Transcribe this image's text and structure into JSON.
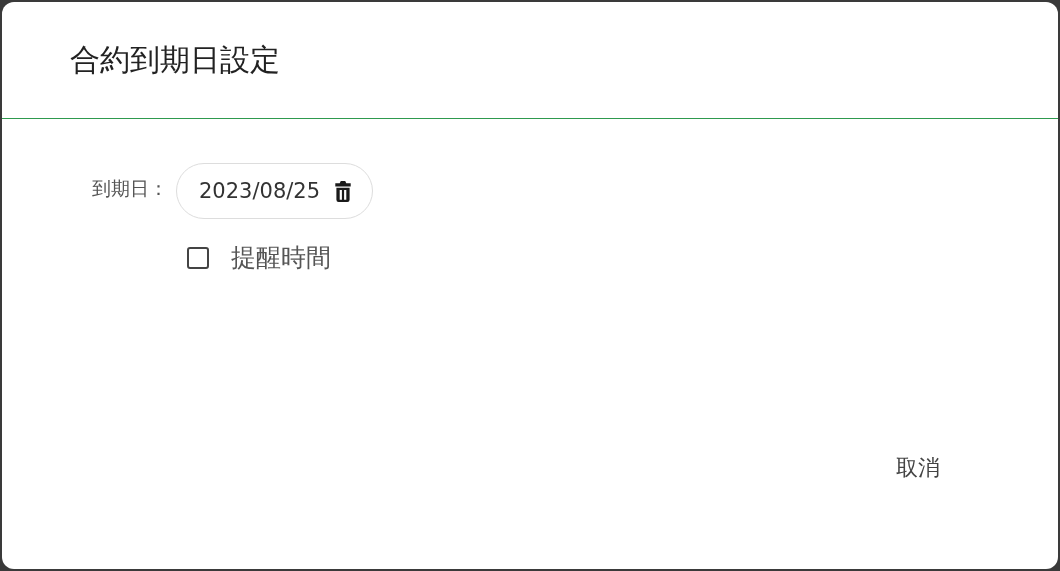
{
  "dialog": {
    "title": "合約到期日設定",
    "due_date": {
      "label": "到期日：",
      "value": "2023/08/25"
    },
    "reminder": {
      "label": "提醒時間",
      "checked": false
    },
    "buttons": [
      {
        "label": "取消",
        "kind": "text"
      }
    ]
  }
}
